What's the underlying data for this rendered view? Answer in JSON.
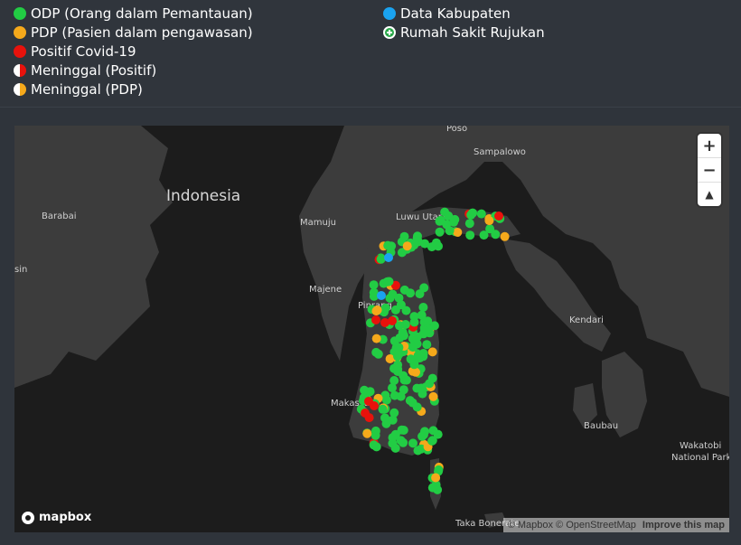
{
  "legend": {
    "left": [
      {
        "label": "ODP (Orang dalam Pemantauan)",
        "color": "#22cc44",
        "icon": "green-dot-icon"
      },
      {
        "label": "PDP (Pasien dalam pengawasan)",
        "color": "#f5a91b",
        "icon": "orange-dot-icon"
      },
      {
        "label": "Positif Covid-19",
        "color": "#e8120c",
        "icon": "red-dot-icon"
      },
      {
        "label": "Meninggal (Positif)",
        "color": "#e8120c",
        "icon": "half-red-dot-icon"
      },
      {
        "label": "Meninggal (PDP)",
        "color": "#f5a91b",
        "icon": "half-orange-dot-icon"
      }
    ],
    "right": [
      {
        "label": "Data Kabupaten",
        "color": "#1aa3f0",
        "icon": "blue-dot-icon"
      },
      {
        "label": "Rumah Sakit Rujukan",
        "color": "#2aa84a",
        "icon": "hospital-cross-icon"
      }
    ]
  },
  "map": {
    "labels": {
      "indonesia": "Indonesia",
      "poso": "Poso",
      "sampalowo": "Sampalowo",
      "barabai": "Barabai",
      "mamuju": "Mamuju",
      "luwu_utara": "Luwu Utara",
      "sin": "sin",
      "majene": "Majene",
      "pinrang": "Pinrang",
      "kendari": "Kendari",
      "makassar": "Makassar",
      "baubau": "Baubau",
      "wakatobi": "Wakatobi\nNational Park",
      "taka_bonerate": "Taka Bonerate"
    },
    "zoom_in": "+",
    "zoom_out": "−",
    "compass": "▲",
    "logo": "mapbox",
    "attribution": "© Mapbox © OpenStreetMap",
    "improve": "Improve this map",
    "colors": {
      "land": "#3c3c3c",
      "water": "#1c1c1c",
      "odp": "#22cc44",
      "pdp": "#f5a91b",
      "positif": "#e8120c",
      "kabupaten": "#1aa3f0"
    }
  }
}
